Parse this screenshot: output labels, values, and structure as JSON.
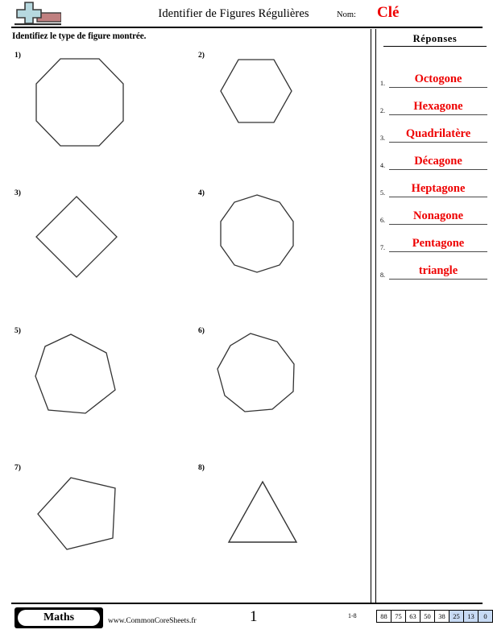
{
  "header": {
    "logo_icon": "plus-block-logo",
    "title": "Identifier de Figures Régulières",
    "name_label": "Nom:",
    "name_value": "Clé"
  },
  "instruction": "Identifiez le type de figure montrée.",
  "answers": {
    "heading": "Réponses",
    "items": [
      {
        "num": "1.",
        "text": "Octogone"
      },
      {
        "num": "2.",
        "text": "Hexagone"
      },
      {
        "num": "3.",
        "text": "Quadrilatère"
      },
      {
        "num": "4.",
        "text": "Décagone"
      },
      {
        "num": "5.",
        "text": "Heptagone"
      },
      {
        "num": "6.",
        "text": "Nonagone"
      },
      {
        "num": "7.",
        "text": "Pentagone"
      },
      {
        "num": "8.",
        "text": "triangle"
      }
    ]
  },
  "problems": [
    {
      "num": "1)",
      "shape": "octagon",
      "sides": 8,
      "answer": "Octogone"
    },
    {
      "num": "2)",
      "shape": "hexagon",
      "sides": 6,
      "answer": "Hexagone"
    },
    {
      "num": "3)",
      "shape": "quadrilateral",
      "sides": 4,
      "answer": "Quadrilatère"
    },
    {
      "num": "4)",
      "shape": "decagon",
      "sides": 10,
      "answer": "Décagone"
    },
    {
      "num": "5)",
      "shape": "heptagon",
      "sides": 7,
      "answer": "Heptagone"
    },
    {
      "num": "6)",
      "shape": "nonagon",
      "sides": 9,
      "answer": "Nonagone"
    },
    {
      "num": "7)",
      "shape": "pentagon",
      "sides": 5,
      "answer": "Pentagone"
    },
    {
      "num": "8)",
      "shape": "triangle",
      "sides": 3,
      "answer": "triangle"
    }
  ],
  "footer": {
    "subject_badge": "Maths",
    "site": "www.CommonCoreSheets.fr",
    "page_number": "1",
    "score_range": "1-8",
    "score_cells": [
      {
        "value": "88",
        "highlight": false
      },
      {
        "value": "75",
        "highlight": false
      },
      {
        "value": "63",
        "highlight": false
      },
      {
        "value": "50",
        "highlight": false
      },
      {
        "value": "38",
        "highlight": false
      },
      {
        "value": "25",
        "highlight": true
      },
      {
        "value": "13",
        "highlight": true
      },
      {
        "value": "0",
        "highlight": true
      }
    ]
  },
  "colors": {
    "answer_red": "#ee0000",
    "score_highlight": "#c7daf4",
    "logo_blue": "#b6d8df",
    "logo_red": "#c08080",
    "rule_black": "#000000"
  }
}
